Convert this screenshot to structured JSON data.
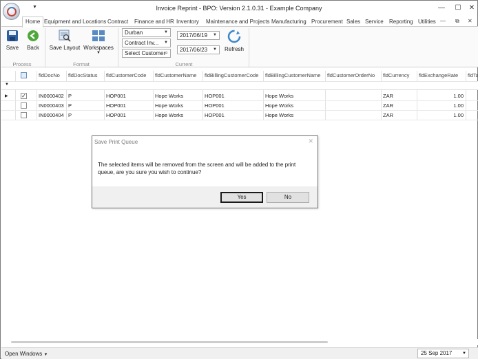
{
  "window": {
    "title": "Invoice Reprint - BPO: Version 2.1.0.31 - Example Company",
    "controls": {
      "minimize": "—",
      "maximize": "☐",
      "close": "✕"
    }
  },
  "ribbon_tabs": [
    "Home",
    "Equipment and Locations",
    "Contract",
    "Finance and HR",
    "Inventory",
    "Maintenance and Projects",
    "Manufacturing",
    "Procurement",
    "Sales",
    "Service",
    "Reporting",
    "Utilities"
  ],
  "ribbon": {
    "save_label": "Save",
    "back_label": "Back",
    "save_layout_label": "Save Layout",
    "workspaces_label": "Workspaces",
    "refresh_label": "Refresh",
    "groups": {
      "process": "Process",
      "format": "Format",
      "current": "Current"
    },
    "site_combo": "Durban",
    "doctype_combo": "Contract Inv...",
    "customer_combo": "Select Customer",
    "date_from": "2017/06/19",
    "date_to": "2017/06/23"
  },
  "grid": {
    "columns": [
      "fldDocNo",
      "fldDocStatus",
      "fldCustomerCode",
      "fldCustomerName",
      "fldBillingCustomerCode",
      "fldBillingCustomerName",
      "fldCustomerOrderNo",
      "fldCurrency",
      "fldExchangeRate",
      "fldTa"
    ],
    "rows": [
      {
        "checked": true,
        "doc_no": "IN0000402",
        "status": "P",
        "customer_code": "HOP001",
        "customer_name": "Hope Works",
        "billing_code": "HOP001",
        "billing_name": "Hope Works",
        "order_no": "",
        "currency": "ZAR",
        "exchange_rate": "1.00"
      },
      {
        "checked": false,
        "doc_no": "IN0000403",
        "status": "P",
        "customer_code": "HOP001",
        "customer_name": "Hope Works",
        "billing_code": "HOP001",
        "billing_name": "Hope Works",
        "order_no": "",
        "currency": "ZAR",
        "exchange_rate": "1.00"
      },
      {
        "checked": false,
        "doc_no": "IN0000404",
        "status": "P",
        "customer_code": "HOP001",
        "customer_name": "Hope Works",
        "billing_code": "HOP001",
        "billing_name": "Hope Works",
        "order_no": "",
        "currency": "ZAR",
        "exchange_rate": "1.00"
      }
    ]
  },
  "dialog": {
    "title": "Save Print Queue",
    "close": "✕",
    "message": "The selected items will be removed from the screen and will be added to the print queue, are you sure you wish to continue?",
    "yes_label": "Yes",
    "no_label": "No"
  },
  "statusbar": {
    "open_windows_label": "Open Windows",
    "date": "25 Sep 2017"
  },
  "colors": {
    "save_icon": "#2f5f9e",
    "back_icon": "#4ea73a",
    "refresh_icon": "#3a86c8",
    "workspaces_icon": "#5a8ac2"
  }
}
